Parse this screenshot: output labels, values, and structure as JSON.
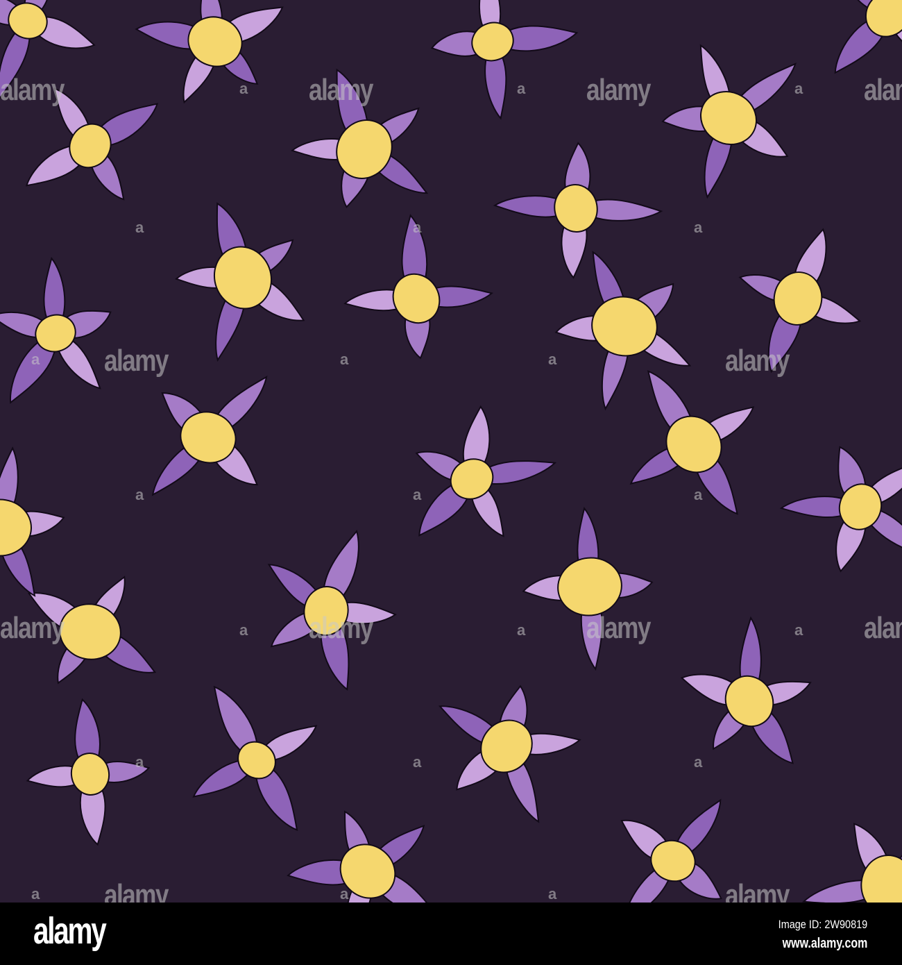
{
  "pattern": {
    "background_color": "#2a1d33",
    "petal_colors": [
      "#a57bc7",
      "#c9a3dd",
      "#8e63b8"
    ],
    "center_color": "#f5d76e",
    "outline_color": "#120a18",
    "watermark_text": "alamy",
    "watermark_glyph": "a"
  },
  "footer": {
    "logo": "alamy",
    "image_id": "Image ID: 2W90819",
    "website": "www.alamy.com"
  }
}
